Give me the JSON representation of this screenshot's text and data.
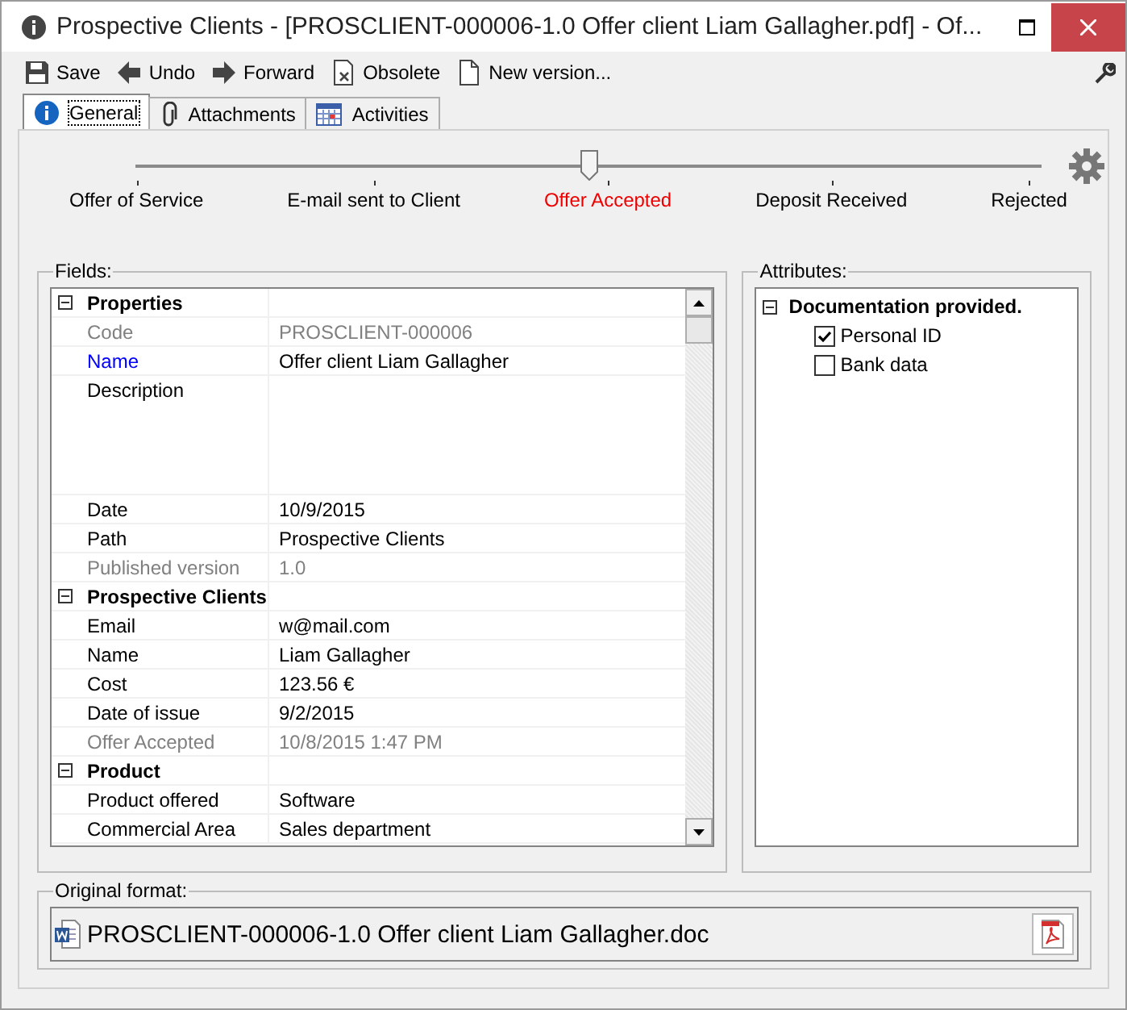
{
  "window": {
    "title": "Prospective Clients - [PROSCLIENT-000006-1.0 Offer client Liam Gallagher.pdf] - Of..."
  },
  "toolbar": [
    {
      "kind": "save",
      "label": "Save"
    },
    {
      "kind": "back",
      "label": "Undo"
    },
    {
      "kind": "forward",
      "label": "Forward"
    },
    {
      "kind": "obsolete",
      "label": "Obsolete"
    },
    {
      "kind": "new",
      "label": "New version..."
    }
  ],
  "tabs": [
    {
      "kind": "info",
      "label": "General",
      "selected": true
    },
    {
      "kind": "clip",
      "label": "Attachments",
      "selected": false
    },
    {
      "kind": "calendar",
      "label": "Activities",
      "selected": false
    }
  ],
  "workflow": {
    "level": 0.5,
    "stages": [
      {
        "label": "Offer of Service",
        "selected": false
      },
      {
        "label": "E-mail sent to Client",
        "selected": false
      },
      {
        "label": "Offer Accepted",
        "selected": true
      },
      {
        "label": "Deposit Received",
        "selected": false
      },
      {
        "label": "Rejected",
        "selected": false
      }
    ]
  },
  "fields": {
    "title": "Fields:",
    "groups": [
      {
        "label": "Properties",
        "expanded": true,
        "rows": [
          {
            "kind": "readonly",
            "name": "Code",
            "value": "PROSCLIENT-000006"
          },
          {
            "kind": "required",
            "name": "Name",
            "value": "Offer client Liam Gallagher"
          },
          {
            "kind": "multiline",
            "name": "Description"
          },
          {
            "kind": "normal",
            "name": "Date",
            "value": "10/9/2015"
          },
          {
            "kind": "normal",
            "name": "Path",
            "value": "Prospective Clients"
          },
          {
            "kind": "readonly",
            "name": "Published version",
            "value": "1.0"
          }
        ]
      },
      {
        "label": "Prospective Clients",
        "expanded": true,
        "rows": [
          {
            "kind": "normal",
            "name": "Email",
            "value": "w@mail.com"
          },
          {
            "kind": "normal",
            "name": "Name",
            "value": "Liam Gallagher"
          },
          {
            "kind": "normal",
            "name": "Cost",
            "value": "123.56 €"
          },
          {
            "kind": "normal",
            "name": "Date of issue",
            "value": "9/2/2015"
          },
          {
            "kind": "readonly",
            "name": "Offer Accepted",
            "value": "10/8/2015 1:47 PM"
          }
        ]
      },
      {
        "label": "Product",
        "expanded": true,
        "rows": [
          {
            "kind": "normal",
            "name": "Product offered",
            "value": "Software"
          },
          {
            "kind": "normal",
            "name": "Commercial Area",
            "value": "Sales department"
          }
        ]
      }
    ]
  },
  "attributes": {
    "title": "Attributes:",
    "groups": [
      {
        "label": "Documentation provided.",
        "expanded": true,
        "items": [
          {
            "label": "Personal ID",
            "checked": true
          },
          {
            "label": "Bank data",
            "checked": false
          }
        ]
      }
    ]
  },
  "original_format": {
    "title": "Original format:",
    "file": "PROSCLIENT-000006-1.0 Offer client Liam Gallagher.doc"
  }
}
